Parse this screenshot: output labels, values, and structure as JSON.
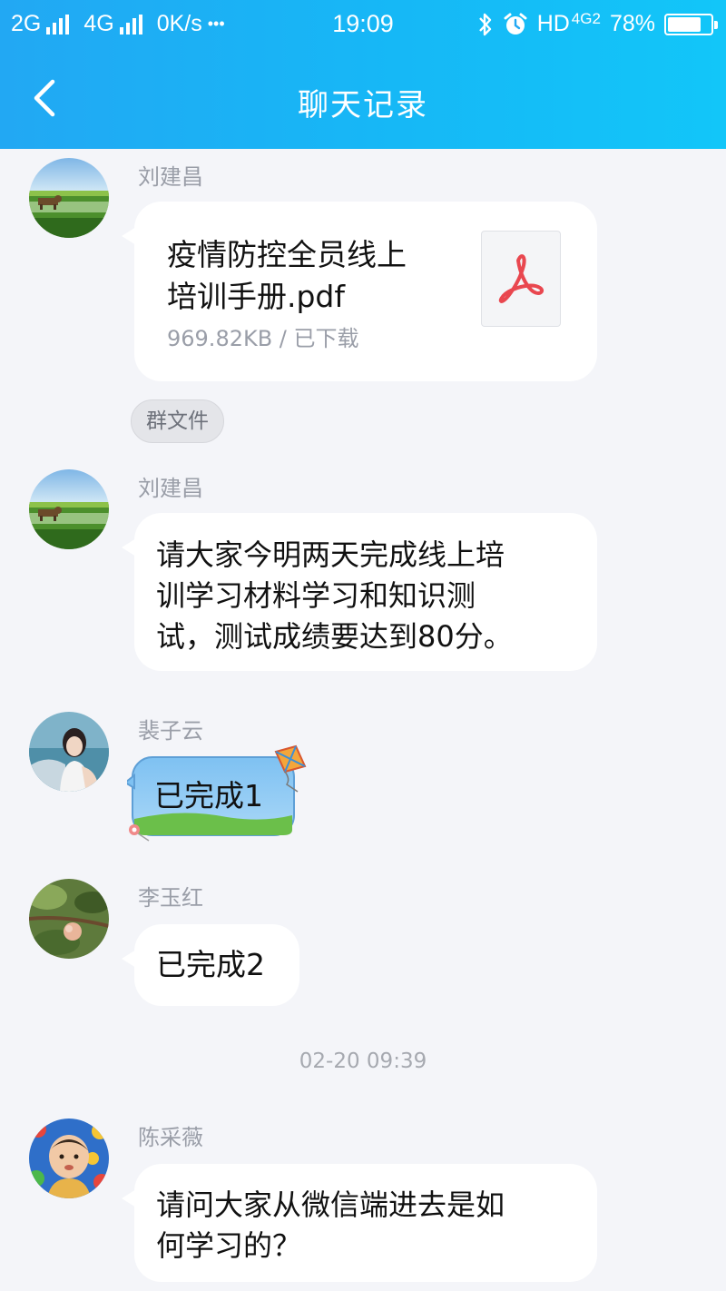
{
  "status_bar": {
    "net1": "2G",
    "net2": "4G",
    "speed": "0K/s",
    "more": "•••",
    "time": "19:09",
    "hd": "HD",
    "net3": "4G",
    "net3_sub": "2",
    "battery": "78%",
    "battery_level": 0.78
  },
  "nav": {
    "title": "聊天记录"
  },
  "messages": [
    {
      "sender": "刘建昌",
      "file_name_line1": "疫情防控全员线上",
      "file_name_line2": "培训手册.pdf",
      "file_meta": "969.82KB / 已下载",
      "tag": "群文件"
    },
    {
      "sender": "刘建昌",
      "lines": [
        "请大家今明两天完成线上培",
        "训学习材料学习和知识测",
        "试，测试成绩要达到80分。"
      ]
    },
    {
      "sender": "裴子云",
      "text": "已完成1"
    },
    {
      "sender": "李玉红",
      "text": "已完成2"
    },
    {
      "sender": "陈采薇",
      "lines": [
        "请问大家从微信端进去是如",
        "何学习的？"
      ]
    }
  ],
  "timestamp": "02-20 09:39",
  "colors": {
    "header_start": "#22a8f3",
    "header_end": "#12c6f9",
    "background": "#f4f5f9",
    "bubble": "#ffffff",
    "pdf_red": "#e9474f"
  }
}
